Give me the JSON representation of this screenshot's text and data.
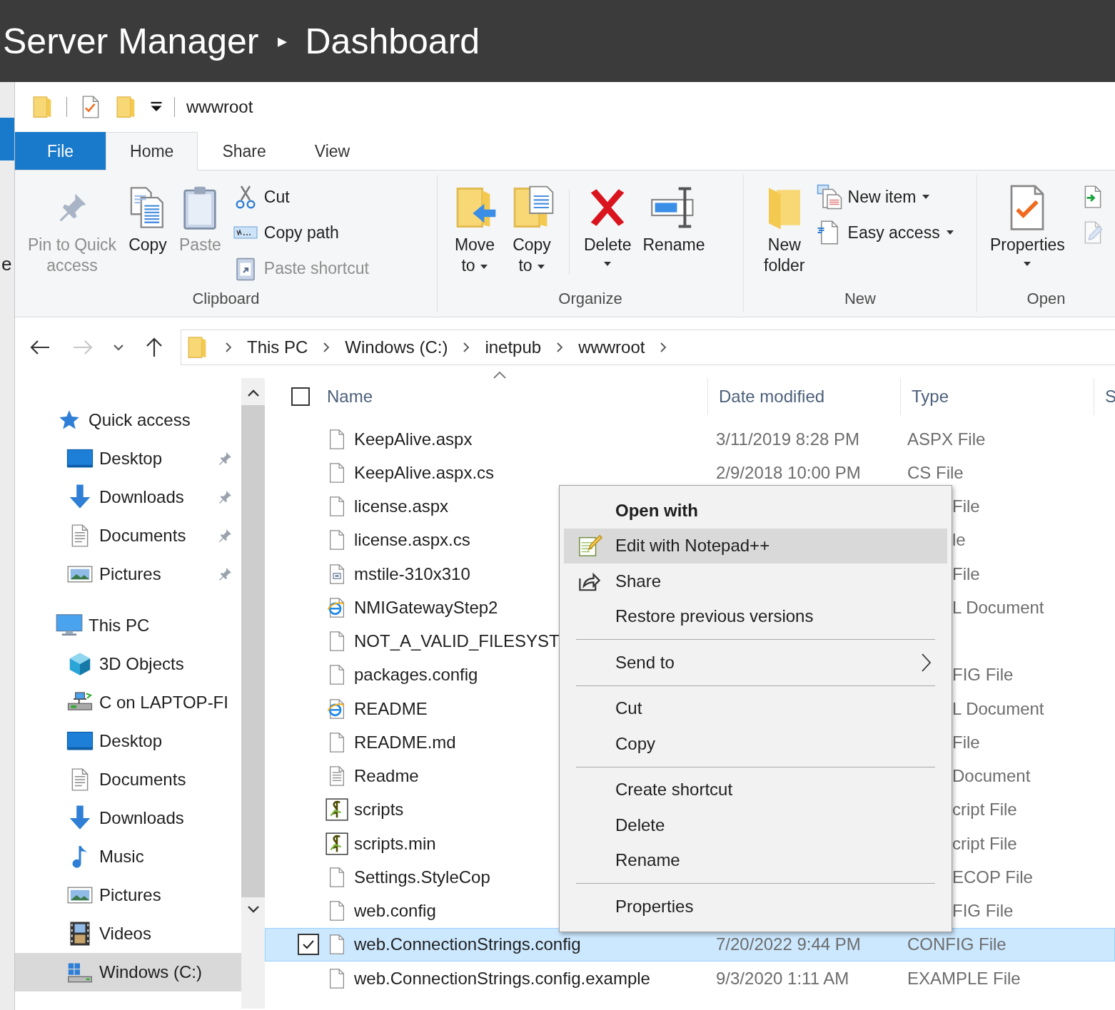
{
  "title_bar": {
    "app": "Server Manager",
    "separator": "▸",
    "page": "Dashboard"
  },
  "background_text": "e",
  "quick_access_toolbar": {
    "title": "wwwroot"
  },
  "ribbon_tabs": [
    {
      "label": "File",
      "kind": "file",
      "selected": false
    },
    {
      "label": "Home",
      "kind": "tab",
      "selected": true
    },
    {
      "label": "Share",
      "kind": "tab",
      "selected": false
    },
    {
      "label": "View",
      "kind": "tab",
      "selected": false
    }
  ],
  "ribbon": {
    "groups": [
      {
        "label": "Clipboard",
        "items": [
          {
            "kind": "large",
            "label": "Pin to Quick\naccess",
            "disabled": true,
            "dropdown": false
          },
          {
            "kind": "large",
            "label": "Copy",
            "disabled": false,
            "dropdown": false
          },
          {
            "kind": "large",
            "label": "Paste",
            "disabled": true,
            "dropdown": false
          },
          {
            "kind": "small",
            "label": "Cut",
            "disabled": false,
            "dropdown": false
          },
          {
            "kind": "small",
            "label": "Copy path",
            "disabled": false,
            "dropdown": false
          },
          {
            "kind": "small",
            "label": "Paste shortcut",
            "disabled": true,
            "dropdown": false
          }
        ]
      },
      {
        "label": "Organize",
        "items": [
          {
            "kind": "large",
            "label": "Move\nto",
            "disabled": false,
            "dropdown": true
          },
          {
            "kind": "large",
            "label": "Copy\nto",
            "disabled": false,
            "dropdown": true
          },
          {
            "kind": "divider"
          },
          {
            "kind": "large",
            "label": "Delete",
            "disabled": false,
            "dropdown": true
          },
          {
            "kind": "large",
            "label": "Rename",
            "disabled": false,
            "dropdown": false
          }
        ]
      },
      {
        "label": "New",
        "items": [
          {
            "kind": "large",
            "label": "New\nfolder",
            "disabled": false,
            "dropdown": false
          },
          {
            "kind": "small",
            "label": "New item",
            "disabled": false,
            "dropdown": true
          },
          {
            "kind": "small",
            "label": "Easy access",
            "disabled": false,
            "dropdown": true
          }
        ]
      },
      {
        "label": "Open",
        "items": [
          {
            "kind": "large",
            "label": "Properties",
            "disabled": false,
            "dropdown": true
          },
          {
            "kind": "icon",
            "disabled": false
          },
          {
            "kind": "icon",
            "disabled": true
          }
        ]
      }
    ]
  },
  "address_bar": {
    "crumbs": [
      "This PC",
      "Windows (C:)",
      "inetpub",
      "wwwroot"
    ]
  },
  "navigation": [
    {
      "label": "Quick access",
      "kind": "star",
      "selected": false,
      "children": [
        {
          "label": "Desktop",
          "kind": "desktop",
          "pinned": true,
          "selected": false
        },
        {
          "label": "Downloads",
          "kind": "downloads",
          "pinned": true,
          "selected": false
        },
        {
          "label": "Documents",
          "kind": "documents",
          "pinned": true,
          "selected": false
        },
        {
          "label": "Pictures",
          "kind": "pictures",
          "pinned": true,
          "selected": false
        }
      ]
    },
    {
      "label": "This PC",
      "kind": "pc",
      "selected": false,
      "children": [
        {
          "label": "3D Objects",
          "kind": "objects",
          "pinned": false,
          "selected": false
        },
        {
          "label": "C on LAPTOP-FI",
          "kind": "network",
          "pinned": false,
          "selected": false
        },
        {
          "label": "Desktop",
          "kind": "desktop",
          "pinned": false,
          "selected": false
        },
        {
          "label": "Documents",
          "kind": "documents",
          "pinned": false,
          "selected": false
        },
        {
          "label": "Downloads",
          "kind": "downloads",
          "pinned": false,
          "selected": false
        },
        {
          "label": "Music",
          "kind": "music",
          "pinned": false,
          "selected": false
        },
        {
          "label": "Pictures",
          "kind": "pictures",
          "pinned": false,
          "selected": false
        },
        {
          "label": "Videos",
          "kind": "videos",
          "pinned": false,
          "selected": false
        },
        {
          "label": "Windows (C:)",
          "kind": "drive",
          "pinned": false,
          "selected": true
        }
      ]
    }
  ],
  "file_list": {
    "columns": [
      "Name",
      "Date modified",
      "Type",
      "S"
    ],
    "select_all": {
      "checked": false
    },
    "rows": [
      {
        "name": "KeepAlive.aspx",
        "date": "3/11/2019 8:28 PM",
        "type": "ASPX File",
        "kind": "blank",
        "covered": false,
        "selected": false
      },
      {
        "name": "KeepAlive.aspx.cs",
        "date": "2/9/2018 10:00 PM",
        "type": "CS File",
        "kind": "blank",
        "covered": false,
        "selected": false
      },
      {
        "name": "license.aspx",
        "type": "File",
        "kind": "blank",
        "covered": true,
        "selected": false
      },
      {
        "name": "license.aspx.cs",
        "type": "le",
        "kind": "blank",
        "covered": true,
        "selected": false
      },
      {
        "name": "mstile-310x310",
        "type": "File",
        "kind": "image",
        "covered": true,
        "selected": false
      },
      {
        "name": "NMIGatewayStep2",
        "type": "L Document",
        "kind": "web",
        "covered": true,
        "selected": false
      },
      {
        "name": "NOT_A_VALID_FILESYST",
        "kind": "blank",
        "selected": false
      },
      {
        "name": "packages.config",
        "type": "FIG File",
        "kind": "blank",
        "covered": true,
        "selected": false
      },
      {
        "name": "README",
        "type": "L Document",
        "kind": "web",
        "covered": true,
        "selected": false
      },
      {
        "name": "README.md",
        "type": "File",
        "kind": "blank",
        "covered": true,
        "selected": false
      },
      {
        "name": "Readme",
        "type": "Document",
        "kind": "text",
        "covered": true,
        "selected": false
      },
      {
        "name": "scripts",
        "type": "cript File",
        "kind": "script",
        "covered": true,
        "selected": false
      },
      {
        "name": "scripts.min",
        "type": "cript File",
        "kind": "script",
        "covered": true,
        "selected": false
      },
      {
        "name": "Settings.StyleCop",
        "type": "ECOP File",
        "kind": "blank",
        "covered": true,
        "selected": false
      },
      {
        "name": "web.config",
        "type": "FIG File",
        "kind": "blank",
        "covered": true,
        "selected": false
      },
      {
        "name": "web.ConnectionStrings.config",
        "date": "7/20/2022 9:44 PM",
        "type": "CONFIG File",
        "kind": "blank",
        "covered": false,
        "selected": true
      },
      {
        "name": "web.ConnectionStrings.config.example",
        "date": "9/3/2020 1:11 AM",
        "type": "EXAMPLE File",
        "kind": "blank",
        "covered": false,
        "selected": false
      }
    ]
  },
  "context_menu": [
    {
      "kind": "item",
      "label": "Open with",
      "default": true,
      "highlighted": false,
      "submenu": false
    },
    {
      "kind": "item",
      "label": "Edit with Notepad++",
      "default": false,
      "highlighted": true,
      "submenu": false
    },
    {
      "kind": "item",
      "label": "Share",
      "default": false,
      "highlighted": false,
      "submenu": false
    },
    {
      "kind": "item",
      "label": "Restore previous versions",
      "default": false,
      "highlighted": false,
      "submenu": false
    },
    {
      "kind": "separator"
    },
    {
      "kind": "item",
      "label": "Send to",
      "default": false,
      "highlighted": false,
      "submenu": true
    },
    {
      "kind": "separator"
    },
    {
      "kind": "item",
      "label": "Cut",
      "default": false,
      "highlighted": false,
      "submenu": false
    },
    {
      "kind": "item",
      "label": "Copy",
      "default": false,
      "highlighted": false,
      "submenu": false
    },
    {
      "kind": "separator"
    },
    {
      "kind": "item",
      "label": "Create shortcut",
      "default": false,
      "highlighted": false,
      "submenu": false
    },
    {
      "kind": "item",
      "label": "Delete",
      "default": false,
      "highlighted": false,
      "submenu": false
    },
    {
      "kind": "item",
      "label": "Rename",
      "default": false,
      "highlighted": false,
      "submenu": false
    },
    {
      "kind": "separator"
    },
    {
      "kind": "item",
      "label": "Properties",
      "default": false,
      "highlighted": false,
      "submenu": false
    }
  ]
}
